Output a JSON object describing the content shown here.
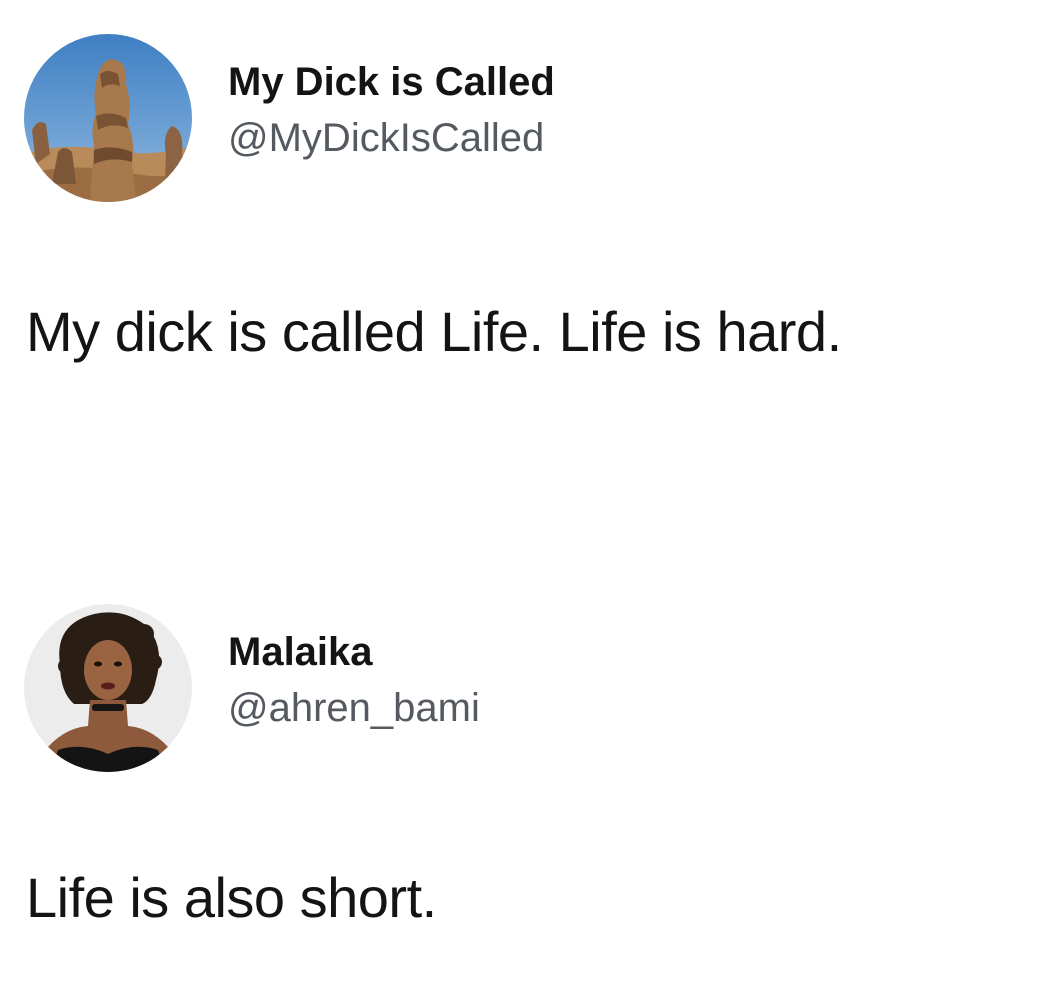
{
  "tweets": [
    {
      "display_name": "My Dick is Called",
      "handle": "@MyDickIsCalled",
      "text": "My dick is called Life. Life is hard.",
      "avatar_icon": "rock-formation-photo"
    },
    {
      "display_name": "Malaika",
      "handle": "@ahren_bami",
      "text": "Life is also short.",
      "avatar_icon": "portrait-photo"
    }
  ],
  "colors": {
    "text": "#141414",
    "handle": "#555a60",
    "background": "#ffffff"
  }
}
